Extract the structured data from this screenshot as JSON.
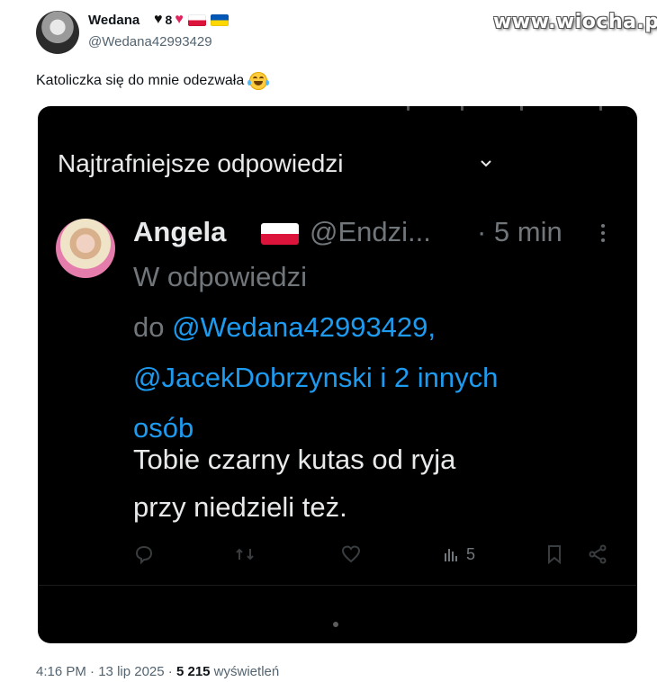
{
  "author": {
    "name": "Wedana",
    "name_suffix_number": "8",
    "handle": "@Wedana42993429"
  },
  "watermark": "www.wiocha.pl",
  "tweet": {
    "text": "Katoliczka się do mnie odezwała",
    "emoji": "face-with-tears-of-joy"
  },
  "embedded": {
    "section_title": "Najtrafniejsze odpowiedzi",
    "reply": {
      "name": "Angela",
      "handle": "@Endzi...",
      "time": "· 5 min",
      "context_line1": "W odpowiedzi",
      "context_prefix": "do ",
      "mention1": "@Wedana42993429,",
      "mention2": "@JacekDobrzynski i 2 innych",
      "mention3": "osób",
      "body_line1": "Tobie czarny kutas od ryja",
      "body_line2": "przy niedzieli też.",
      "views": "5"
    }
  },
  "meta": {
    "time": "4:16 PM",
    "sep1": " · ",
    "date": "13 lip 2025",
    "sep2": " · ",
    "views_count": "5 215",
    "views_label": " wyświetleń"
  },
  "colors": {
    "link": "#1d9bf0",
    "dark_bg": "#000000",
    "muted": "#71767b",
    "flag_red": "#dc143c"
  }
}
